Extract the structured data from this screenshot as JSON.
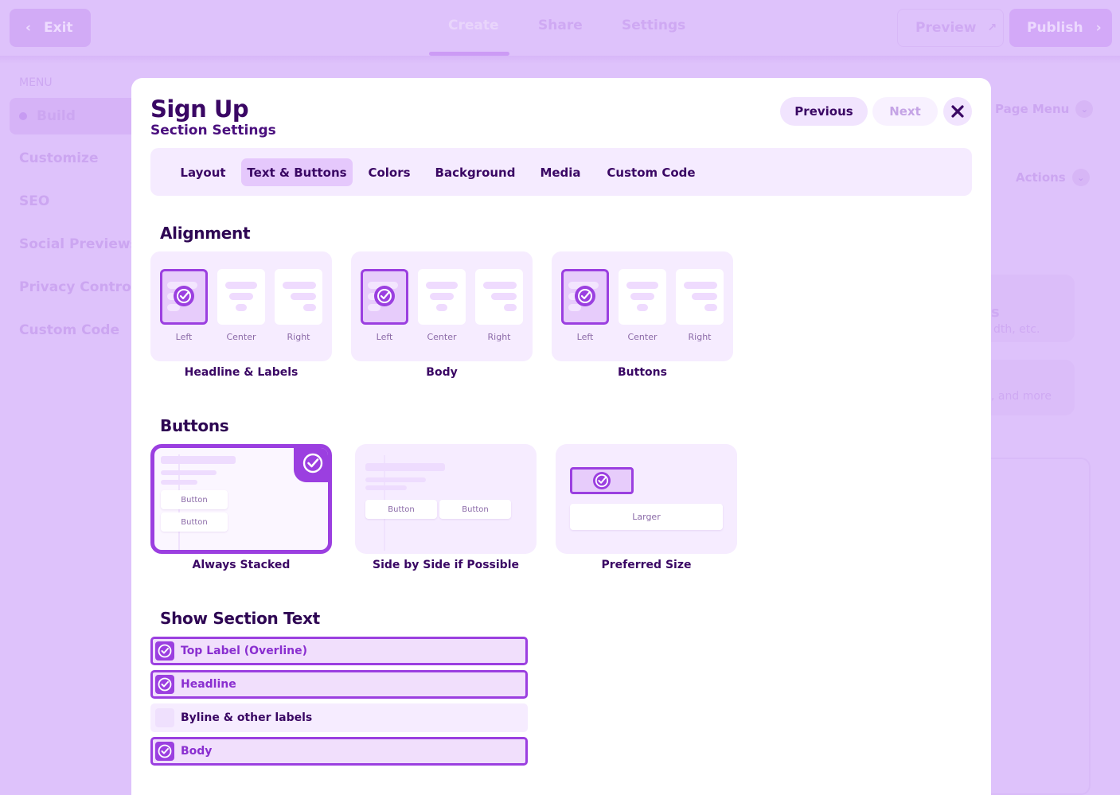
{
  "topbar": {
    "exit_label": "Exit",
    "tabs": [
      "Create",
      "Share",
      "Settings"
    ],
    "preview_label": "Preview",
    "publish_label": "Publish"
  },
  "sidebar": {
    "menu_title": "MENU",
    "items": [
      "Build",
      "Customize",
      "SEO",
      "Social Previews",
      "Privacy Controls",
      "Custom Code"
    ]
  },
  "background_right": {
    "page_menu_label": "Page Menu",
    "actions_label": "Actions",
    "card1_title_fragment": "s",
    "card1_text_fragment": "dth, etc.",
    "card2_text_fragment": ", and more"
  },
  "modal": {
    "title": "Sign Up",
    "subtitle": "Section Settings",
    "previous_label": "Previous",
    "next_label": "Next",
    "tabs": [
      "Layout",
      "Text & Buttons",
      "Colors",
      "Background",
      "Media",
      "Custom Code"
    ],
    "active_tab": "Text & Buttons",
    "alignment": {
      "heading": "Alignment",
      "option_labels": [
        "Left",
        "Center",
        "Right"
      ],
      "groups": [
        {
          "label": "Headline & Labels",
          "selected": "Left"
        },
        {
          "label": "Body",
          "selected": "Left"
        },
        {
          "label": "Buttons",
          "selected": "Left"
        }
      ]
    },
    "buttons": {
      "heading": "Buttons",
      "button_text": "Button",
      "larger_text": "Larger",
      "options": [
        "Always Stacked",
        "Side by Side if Possible",
        "Preferred Size"
      ],
      "selected": "Always Stacked"
    },
    "show_section_text": {
      "heading": "Show Section Text",
      "items": [
        {
          "label": "Top Label (Overline)",
          "checked": true
        },
        {
          "label": "Headline",
          "checked": true
        },
        {
          "label": "Byline & other labels",
          "checked": false
        },
        {
          "label": "Body",
          "checked": true
        }
      ]
    }
  },
  "colors": {
    "accent": "#9b3fe0",
    "text_dark": "#3a0764",
    "overlay": "#dec2fb",
    "tab_active": "#e5c8fc"
  }
}
